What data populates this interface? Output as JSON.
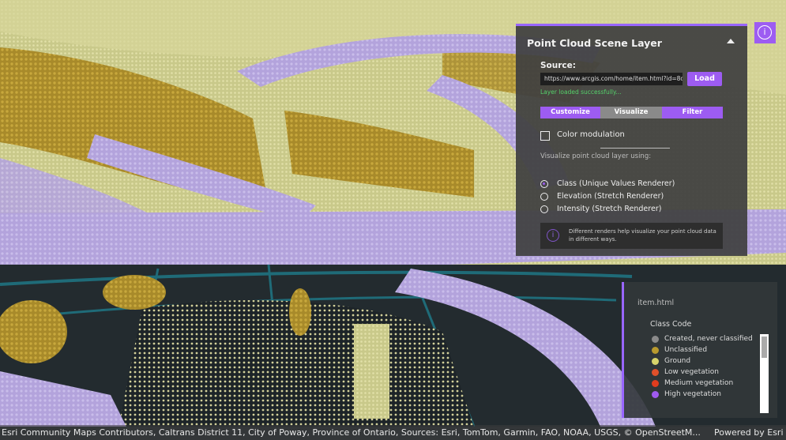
{
  "panel": {
    "title": "Point Cloud Scene Layer",
    "source_label": "Source:",
    "url_value": "https://www.arcgis.com/home/item.html?id=8d",
    "load_label": "Load",
    "status": "Layer loaded successfully...",
    "tabs": [
      {
        "label": "Customize",
        "selected": true
      },
      {
        "label": "Visualize",
        "selected": false
      },
      {
        "label": "Filter",
        "selected": true
      }
    ],
    "color_modulation_label": "Color modulation",
    "visualize_label": "Visualize point cloud layer using:",
    "renderers": [
      {
        "label": "Class (Unique Values Renderer)",
        "checked": true
      },
      {
        "label": "Elevation (Stretch Renderer)",
        "checked": false
      },
      {
        "label": "Intensity (Stretch Renderer)",
        "checked": false
      }
    ],
    "note": "Different renders help visualize your point cloud data in different ways."
  },
  "legend": {
    "title": "item.html",
    "subtitle": "Class Code",
    "items": [
      {
        "label": "Created, never classified",
        "color": "#8a8a8a"
      },
      {
        "label": "Unclassified",
        "color": "#b89a2e"
      },
      {
        "label": "Ground",
        "color": "#d8d46a"
      },
      {
        "label": "Low vegetation",
        "color": "#e0502a"
      },
      {
        "label": "Medium vegetation",
        "color": "#e03c1e"
      },
      {
        "label": "High vegetation",
        "color": "#a05af0"
      }
    ]
  },
  "attribution": "Esri Community Maps Contributors, Caltrans District 11, City of Poway, Province of Ontario, Sources: Esri, TomTom, Garmin, FAO, NOAA, USGS, © OpenStreetM...",
  "powered_by": "Powered by Esri",
  "colors": {
    "accent": "#9d5cf2",
    "lavender": "#b7a6e0",
    "ochre": "#b89a2e",
    "pale_yellow": "#d6d494",
    "teal": "#1f5a66"
  }
}
